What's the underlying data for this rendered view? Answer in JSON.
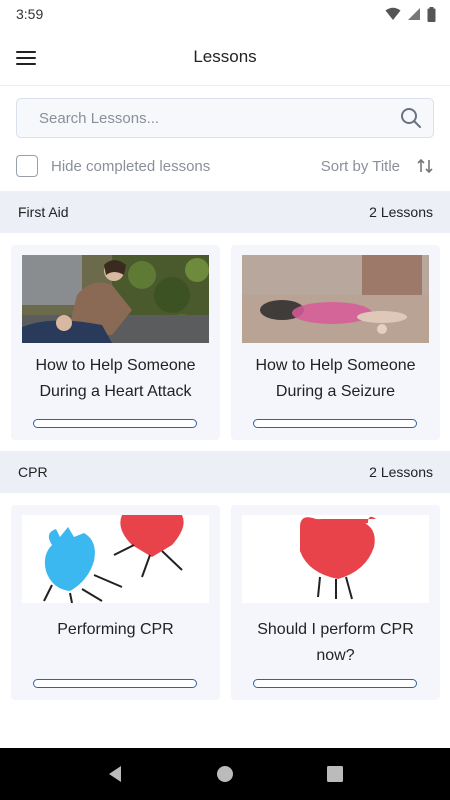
{
  "status_bar": {
    "time": "3:59"
  },
  "app_bar": {
    "title": "Lessons"
  },
  "search": {
    "placeholder": "Search Lessons..."
  },
  "filters": {
    "hide_completed_label": "Hide completed lessons",
    "hide_completed_checked": false,
    "sort_label": "Sort by Title"
  },
  "sections": [
    {
      "name": "First Aid",
      "count_label": "2 Lessons",
      "lessons": [
        {
          "title": "How to Help Someone During a Heart Attack",
          "progress": 0
        },
        {
          "title": "How to Help Someone During a Seizure",
          "progress": 0
        }
      ]
    },
    {
      "name": "CPR",
      "count_label": "2 Lessons",
      "lessons": [
        {
          "title": "Performing CPR",
          "progress": 0
        },
        {
          "title": "Should I perform CPR now?",
          "progress": 0
        }
      ]
    }
  ],
  "colors": {
    "accent": "#3a5fa0",
    "section_bg": "#eceff6",
    "card_bg": "#f4f6fb",
    "heart_red": "#e8434b",
    "heart_blue": "#3bb8ef"
  }
}
